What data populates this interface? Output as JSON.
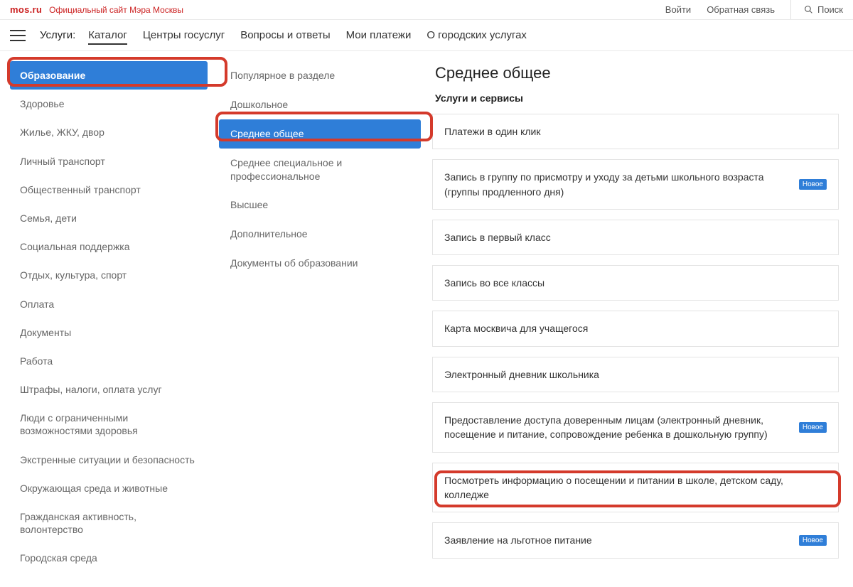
{
  "top": {
    "logo": "mos.ru",
    "tagline": "Официальный сайт Мэра Москвы",
    "login": "Войти",
    "feedback": "Обратная связь",
    "search": "Поиск"
  },
  "nav": {
    "label": "Услуги:",
    "tabs": [
      "Каталог",
      "Центры госуслуг",
      "Вопросы и ответы",
      "Мои платежи",
      "О городских услугах"
    ],
    "active": 0
  },
  "categories": {
    "active": 0,
    "items": [
      "Образование",
      "Здоровье",
      "Жилье, ЖКУ, двор",
      "Личный транспорт",
      "Общественный транспорт",
      "Семья, дети",
      "Социальная поддержка",
      "Отдых, культура, спорт",
      "Оплата",
      "Документы",
      "Работа",
      "Штрафы, налоги, оплата услуг",
      "Люди с ограниченными возможностями здоровья",
      "Экстренные ситуации и безопасность",
      "Окружающая среда и животные",
      "Гражданская активность, волонтерство",
      "Городская среда"
    ]
  },
  "sub": {
    "active": 2,
    "items": [
      "Популярное в разделе",
      "Дошкольное",
      "Среднее общее",
      "Среднее специальное и профессиональное",
      "Высшее",
      "Дополнительное",
      "Документы об образовании"
    ]
  },
  "right": {
    "title": "Среднее общее",
    "subhead": "Услуги и сервисы",
    "badge_text": "Новое",
    "services": [
      {
        "label": "Платежи в один клик",
        "badge": false
      },
      {
        "label": "Запись в группу по присмотру и уходу за детьми школьного возраста (группы продленного дня)",
        "badge": true
      },
      {
        "label": "Запись в первый класс",
        "badge": false
      },
      {
        "label": "Запись во все классы",
        "badge": false
      },
      {
        "label": "Карта москвича для учащегося",
        "badge": false
      },
      {
        "label": "Электронный дневник школьника",
        "badge": false
      },
      {
        "label": "Предоставление доступа доверенным лицам (электронный дневник, посещение и питание, сопровождение ребенка в дошкольную группу)",
        "badge": true
      },
      {
        "label": "Посмотреть информацию о посещении и питании в школе, детском саду, колледже",
        "badge": false
      },
      {
        "label": "Заявление на льготное питание",
        "badge": true
      }
    ]
  }
}
